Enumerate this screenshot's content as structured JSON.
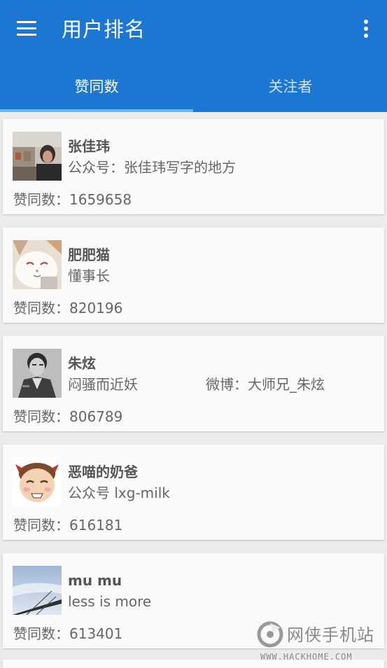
{
  "header": {
    "title": "用户排名",
    "menu_icon": "hamburger-menu-icon",
    "overflow_icon": "more-vertical-icon",
    "background_color": "#1b77d2"
  },
  "tabs": [
    {
      "label": "赞同数",
      "selected": true
    },
    {
      "label": "关注者",
      "selected": false
    }
  ],
  "users": [
    {
      "name": "张佳玮",
      "subtitle": "公众号：张佳玮写字的地方",
      "weibo": "",
      "likes": "赞同数：1659658"
    },
    {
      "name": "肥肥猫",
      "subtitle": "懂事长",
      "weibo": "",
      "likes": "赞同数：820196"
    },
    {
      "name": "朱炫",
      "subtitle": "闷骚而近妖",
      "weibo": "微博：大师兄_朱炫",
      "likes": "赞同数：806789"
    },
    {
      "name": "恶喵的奶爸",
      "subtitle": "公众号 lxg-milk",
      "weibo": "",
      "likes": "赞同数：616181"
    },
    {
      "name": "mu mu",
      "subtitle": "less is more",
      "weibo": "",
      "likes": "赞同数：613401"
    }
  ],
  "watermark": {
    "text_cn": "网侠手机站",
    "url": "WWW.HACKHOME.COM"
  }
}
